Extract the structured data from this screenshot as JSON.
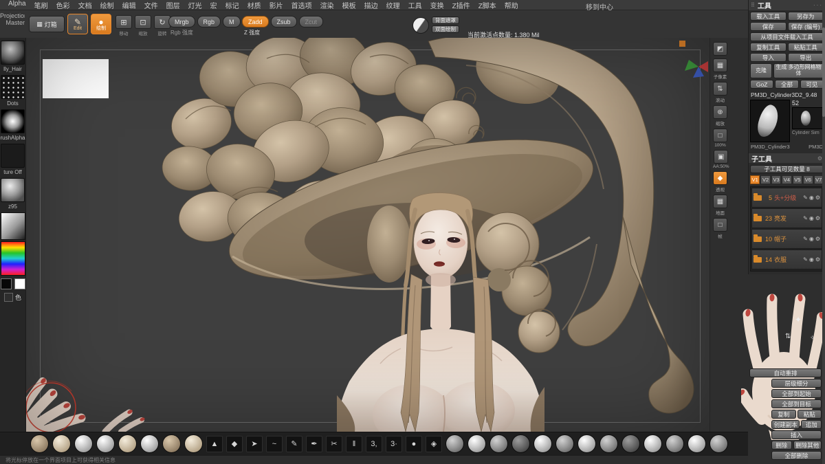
{
  "colors": {
    "accent": "#e8872b",
    "skin": "#eadacd",
    "hair_tan": "#b5a389",
    "canvas_bg": "#3f3f3f"
  },
  "icons": {
    "pen": "✎",
    "eye": "◉",
    "gear": "⚙",
    "diamond": "✦",
    "diamond2": "✧",
    "updown": "⇅",
    "lightbox": "▦",
    "edit": "✎",
    "draw": "●",
    "move": "⊞",
    "scale": "⊡",
    "rotate": "↻",
    "grip": "⠿",
    "header_dots": "···"
  },
  "menu": {
    "items": [
      "Alpha",
      "笔刷",
      "色彩",
      "文档",
      "绘制",
      "编辑",
      "文件",
      "图层",
      "灯光",
      "宏",
      "标记",
      "材质",
      "影片",
      "首选项",
      "渲染",
      "模板",
      "描边",
      "纹理",
      "工具",
      "变换",
      "Z插件",
      "Z脚本",
      "帮助"
    ],
    "right_item": "移到中心"
  },
  "top_shelf": {
    "projection_master": "Projection Master",
    "lightbox": "灯箱",
    "edit_label": "Edit",
    "draw_label": "绘制",
    "move_label": "移动",
    "scale_label": "缩放",
    "rotate_label": "旋转",
    "mrgb": "Mrgb",
    "rgb": "Rgb",
    "m": "M",
    "rgb_intensity": "Rgb 强度",
    "zadd": "Zadd",
    "zsub": "Zsub",
    "zcut": "Zcut",
    "z_intensity": "Z 强度",
    "backface_mask": "背面遮罩",
    "double_sided": "双面绘制",
    "points_counter": "当前激活点数量: 1.380 Mil"
  },
  "left_shelf": {
    "brush_label": "lly_Hair",
    "stroke_label": "Dots",
    "alpha_label": "rushAlpha",
    "texture_label": "ture Off",
    "material_label": "z95",
    "color_label": "色"
  },
  "right_shelf": {
    "items": [
      {
        "glyph": "◩",
        "label": "",
        "state": ""
      },
      {
        "glyph": "▦",
        "label": "子像素",
        "state": ""
      },
      {
        "glyph": "⇅",
        "label": "滚动",
        "state": ""
      },
      {
        "glyph": "⊕",
        "label": "缩放",
        "state": ""
      },
      {
        "glyph": "□",
        "label": "100%",
        "state": ""
      },
      {
        "glyph": "▣",
        "label": "AA:50%",
        "state": ""
      },
      {
        "glyph": "◆",
        "label": "透视",
        "state": "active"
      },
      {
        "glyph": "▦",
        "label": "地面",
        "state": ""
      },
      {
        "glyph": "□",
        "label": "帧",
        "state": ""
      }
    ]
  },
  "tool_panel": {
    "title": "工具",
    "load_tool": "载入工具",
    "save_as": "另存为",
    "save": "保存",
    "save_numbered": "保存 (编号)",
    "load_from_project": "从项目文件载入工具",
    "copy_tool": "复制工具",
    "paste_tool": "粘贴工具",
    "import": "导入",
    "export": "导出",
    "clone": "克隆",
    "make_polymesh": "生成 多边形网格物体",
    "goz": "GoZ",
    "all": "全部",
    "visible": "可见",
    "active_tool": "PM3D_Cylinder3D2_9.48",
    "thumb_badge": "52",
    "thumb_caption": "Cylinder Sim",
    "thumb_label_1": "PM3D_Cylinder3",
    "thumb_label_2": "PM3D"
  },
  "subtool": {
    "title": "子工具",
    "visible_count": "子工具可见数量 8",
    "tabs": [
      {
        "label": "V1",
        "state": "active"
      },
      {
        "label": "V2",
        "state": ""
      },
      {
        "label": "V3",
        "state": ""
      },
      {
        "label": "V4",
        "state": ""
      },
      {
        "label": "V5",
        "state": ""
      },
      {
        "label": "V6",
        "state": ""
      },
      {
        "label": "V7",
        "state": ""
      }
    ],
    "rows": [
      {
        "num": "5",
        "label": "头+分级",
        "tone": "red"
      },
      {
        "num": "23",
        "label": "亮发",
        "tone": "orange"
      },
      {
        "num": "10",
        "label": "帽子",
        "tone": "orange"
      },
      {
        "num": "14",
        "label": "衣服",
        "tone": "orange"
      }
    ],
    "auto_reorder": "自动重排",
    "hier_subdiv": "层级细分",
    "all_to_start": "全部到起始",
    "all_to_target": "全部到目标",
    "copy": "复制",
    "paste": "粘贴",
    "duplicate": "创建副本",
    "append": "追加",
    "insert": "插入",
    "delete": "删除",
    "delete_other": "删除其他",
    "delete_all": "全部删除"
  },
  "bottom_strip": {
    "left_spheres": [
      "tan",
      "cream",
      "white",
      "white",
      "cream",
      "white",
      "tan",
      "cream"
    ],
    "tool_icons": [
      "▲",
      "◆",
      "➤",
      "~",
      "✎",
      "✒",
      "✂",
      "‖",
      "3,",
      "3·",
      "●",
      "◈"
    ],
    "right_spheres": [
      "gray",
      "white",
      "gray",
      "dark",
      "white",
      "gray",
      "white",
      "gray",
      "dark",
      "white",
      "gray",
      "white",
      "gray"
    ]
  },
  "hint": {
    "text": "将光标停放在一个界面项目上可获得相关信息"
  }
}
